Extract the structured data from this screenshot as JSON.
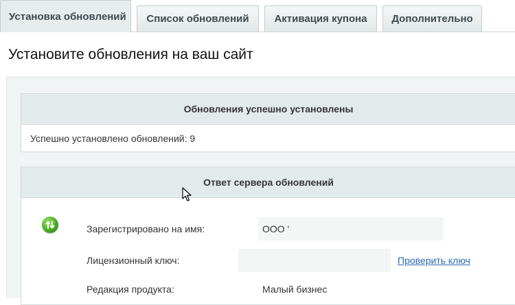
{
  "tabs": [
    {
      "label": "Установка обновлений",
      "active": true
    },
    {
      "label": "Список обновлений",
      "active": false
    },
    {
      "label": "Активация купона",
      "active": false
    },
    {
      "label": "Дополнительно",
      "active": false
    }
  ],
  "page": {
    "title": "Установите обновления на ваш сайт"
  },
  "result": {
    "header": "Обновления успешно установлены",
    "installed_text": "Успешно установлено обновлений: 9"
  },
  "server": {
    "header": "Ответ сервера обновлений",
    "status_icon": "updates-arrows-icon",
    "rows": [
      {
        "label": "Зарегистрировано на имя:",
        "value": "ООО '"
      },
      {
        "label": "Лицензионный ключ:",
        "value": "",
        "link": "Проверить ключ"
      },
      {
        "label": "Редакция продукта:",
        "value": "Малый бизнес"
      }
    ]
  },
  "colors": {
    "accent_link": "#2a6ab0",
    "status_green": "#3a9e1a",
    "header_bg": "#e3eaec"
  }
}
